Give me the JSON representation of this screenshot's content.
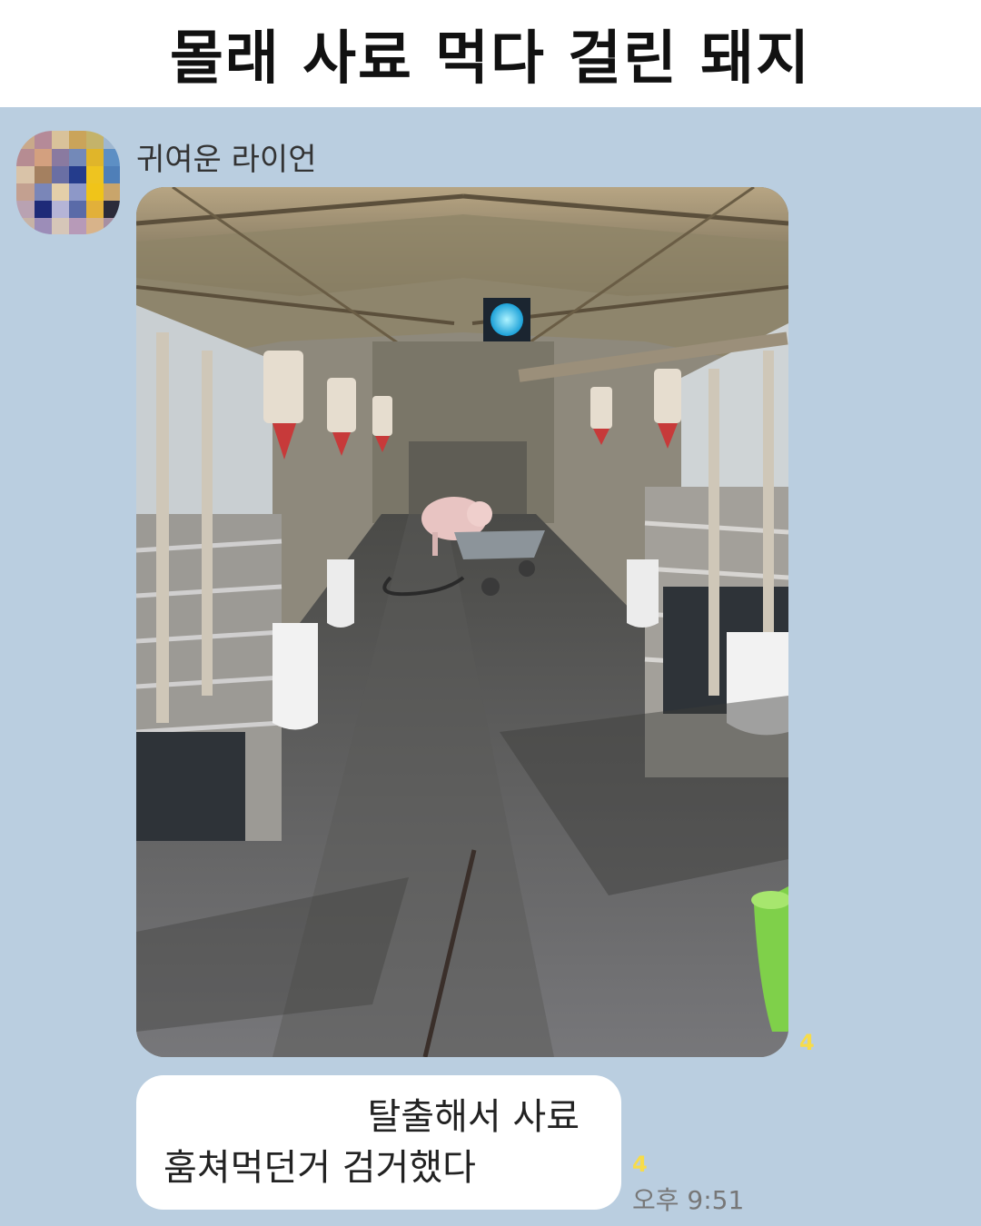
{
  "header": {
    "title": "몰래 사료 먹다 걸린 돼지"
  },
  "chat": {
    "sender_name": "귀여운 라이언",
    "photo_unread_count": "4",
    "message_lines": [
      "탈출해서 사료",
      "훔쳐먹던거 검거했다"
    ],
    "message_unread_count": "4",
    "timestamp": "오후 9:51"
  },
  "colors": {
    "chat_background": "#bacee0",
    "unread_badge": "#f7dc4a",
    "bubble": "#ffffff"
  }
}
